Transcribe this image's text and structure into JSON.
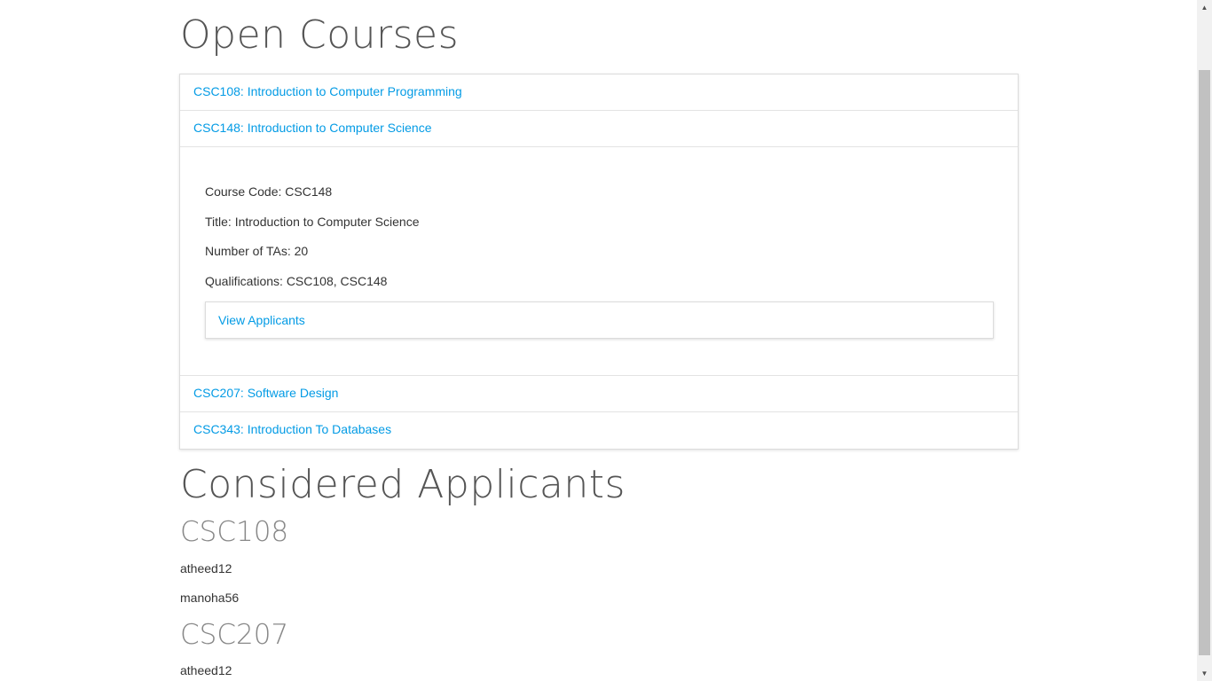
{
  "headings": {
    "open_courses": "Open Courses",
    "considered_applicants": "Considered Applicants"
  },
  "courses": [
    {
      "label": "CSC108: Introduction to Computer Programming"
    },
    {
      "label": "CSC148: Introduction to Computer Science"
    },
    {
      "label": "CSC207: Software Design"
    },
    {
      "label": "CSC343: Introduction To Databases"
    }
  ],
  "expanded_course": {
    "course_code": "Course Code: CSC148",
    "title": "Title: Introduction to Computer Science",
    "num_tas": "Number of TAs: 20",
    "qualifications": "Qualifications: CSC108, CSC148",
    "view_applicants": "View Applicants"
  },
  "considered": [
    {
      "course": "CSC108",
      "applicants": [
        "atheed12",
        "manoha56"
      ]
    },
    {
      "course": "CSC207",
      "applicants": [
        "atheed12"
      ]
    }
  ],
  "colors": {
    "link": "#039be5",
    "heading": "#555555",
    "subheading": "#888888"
  },
  "icons": {
    "scroll_up": "up-arrow",
    "scroll_down": "down-arrow"
  }
}
